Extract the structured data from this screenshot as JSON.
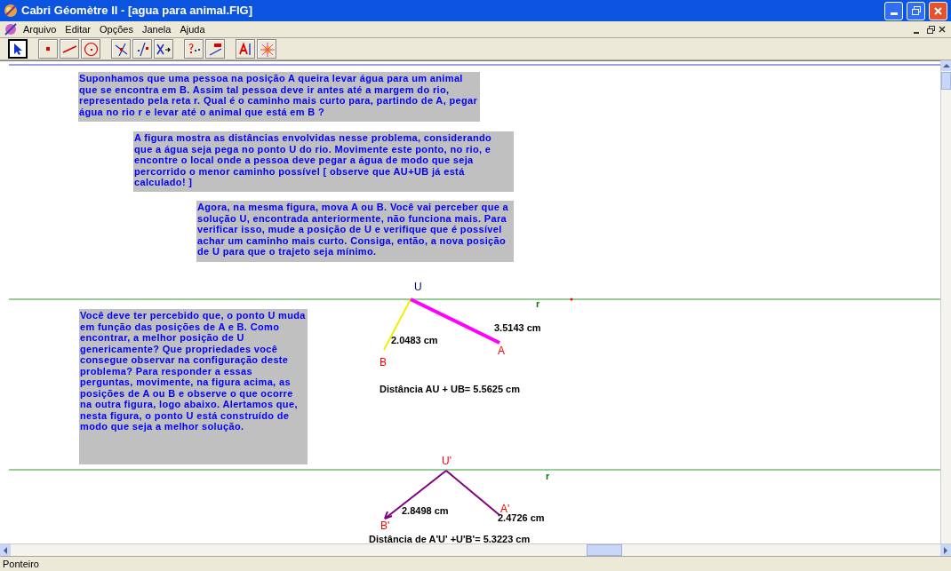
{
  "window": {
    "title": "Cabri Géomètre II - [agua para animal.FIG]"
  },
  "menu": [
    {
      "label": "Arquivo"
    },
    {
      "label": "Editar"
    },
    {
      "label": "Opções"
    },
    {
      "label": "Janela"
    },
    {
      "label": "Ajuda"
    }
  ],
  "tools": [
    {
      "kind": "pointer",
      "selected": true
    },
    {
      "kind": "point",
      "selected": false
    },
    {
      "kind": "line",
      "selected": false
    },
    {
      "kind": "circle",
      "selected": false
    },
    {
      "kind": "perpendicular",
      "selected": false
    },
    {
      "kind": "symmetry",
      "selected": false
    },
    {
      "kind": "macro",
      "selected": false
    },
    {
      "kind": "check",
      "selected": false
    },
    {
      "kind": "measure",
      "selected": false
    },
    {
      "kind": "label",
      "selected": false
    },
    {
      "kind": "display",
      "selected": false
    }
  ],
  "text_boxes": [
    "Suponhamos que uma pessoa na posição A queira levar água para um animal que se encontra em B. Assim tal pessoa deve ir antes até a margem do rio, representado pela reta r. Qual é o caminho mais curto para, partindo de A, pegar água no rio r e levar até o animal que está em B ?",
    "A figura mostra as distâncias envolvidas nesse problema, considerando que a água seja pega no ponto U do rio. Movimente este ponto, no rio, e encontre o local onde a pessoa deve pegar a água de modo que seja percorrido o menor caminho possível [ observe que AU+UB já está calculado! ]",
    "Agora, na mesma figura, mova A ou B. Você vai perceber que a solução U, encontrada anteriormente, não funciona mais. Para verificar isso, mude a posição de U e verifique que é possível achar um caminho mais curto. Consiga, então, a nova posição de U para que o trajeto seja mínimo.",
    "Você deve ter percebido que, o ponto U muda em função das posições de A e B. Como encontrar, a melhor posição de U genericamente? Que propriedades você consegue observar na configuração deste problema? Para responder a essas perguntas, movimente, na figura acima, as posições de A ou B e observe o que ocorre na outra figura, logo abaixo. Alertamos que, nesta figura, o ponto U está construído de modo que seja a melhor solução."
  ],
  "figure_labels": [
    {
      "text": "U",
      "kind": "point",
      "color": "#000080"
    },
    {
      "text": "r",
      "kind": "line",
      "color": "#008000"
    },
    {
      "text": "2.0483  cm",
      "kind": "measure",
      "color": "#000000"
    },
    {
      "text": "3.5143  cm",
      "kind": "measure",
      "color": "#000000"
    },
    {
      "text": "B",
      "kind": "point",
      "color": "#ff0000"
    },
    {
      "text": "A",
      "kind": "point",
      "color": "#ff0000"
    },
    {
      "text": "Distância AU + UB= 5.5625  cm",
      "kind": "measure",
      "color": "#000000"
    },
    {
      "text": "U'",
      "kind": "point",
      "color": "#ff0000"
    },
    {
      "text": "r",
      "kind": "line",
      "color": "#008000"
    },
    {
      "text": "2.8498  cm",
      "kind": "measure",
      "color": "#000000"
    },
    {
      "text": "A'",
      "kind": "point",
      "color": "#ff0000"
    },
    {
      "text": "2.4726  cm",
      "kind": "measure",
      "color": "#000000"
    },
    {
      "text": "B'",
      "kind": "point",
      "color": "#ff0000"
    },
    {
      "text": "Distância de A'U' +U'B'= 5.3223  cm",
      "kind": "measure",
      "color": "#000000"
    }
  ],
  "status_bar": "Ponteiro"
}
